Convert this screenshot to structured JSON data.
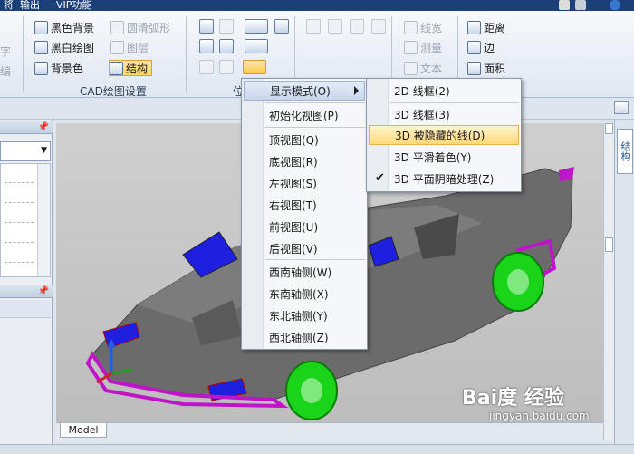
{
  "menubar": {
    "items": [
      "将",
      "输出",
      "VIP功能"
    ]
  },
  "ribbon": {
    "left_fragments": [
      "字",
      "编"
    ],
    "display_group": {
      "items": [
        {
          "label": "黑色背景",
          "enabled": true
        },
        {
          "label": "黑白绘图",
          "enabled": true
        },
        {
          "label": "背景色",
          "enabled": true
        },
        {
          "label": "圆滑弧形",
          "enabled": false
        },
        {
          "label": "图层",
          "enabled": false
        },
        {
          "label": "结构",
          "enabled": true,
          "active": true
        }
      ],
      "label": "CAD绘图设置"
    },
    "position_group_label": "位",
    "measure_group": {
      "items": [
        {
          "label": "线宽",
          "enabled": false
        },
        {
          "label": "测量",
          "enabled": false
        },
        {
          "label": "文本",
          "enabled": false
        },
        {
          "label": "距离",
          "enabled": true
        },
        {
          "label": "边",
          "enabled": true
        },
        {
          "label": "面积",
          "enabled": true
        }
      ]
    }
  },
  "right_panel": {
    "tab_label": "结构"
  },
  "viewport": {
    "model_tab": "Model"
  },
  "context_menu": {
    "items": [
      {
        "label": "显示模式(O)",
        "has_submenu": true,
        "highlighted": true
      },
      {
        "label": "初始化视图(P)"
      },
      {
        "label": "顶视图(Q)"
      },
      {
        "label": "底视图(R)"
      },
      {
        "label": "左视图(S)"
      },
      {
        "label": "右视图(T)"
      },
      {
        "label": "前视图(U)"
      },
      {
        "label": "后视图(V)"
      },
      {
        "label": "西南轴侧(W)"
      },
      {
        "label": "东南轴侧(X)"
      },
      {
        "label": "东北轴侧(Y)"
      },
      {
        "label": "西北轴侧(Z)"
      }
    ]
  },
  "submenu": {
    "items": [
      {
        "label": "2D 线框(2)"
      },
      {
        "label": "3D 线框(3)"
      },
      {
        "label": "3D 被隐藏的线(D)",
        "highlighted": true
      },
      {
        "label": "3D 平滑着色(Y)"
      },
      {
        "label": "3D 平面阴暗处理(Z)",
        "checked": true
      }
    ]
  },
  "watermark": {
    "brand": "Bai度",
    "site_cn": "经验",
    "url": "jingyan.baidu.com"
  },
  "colors": {
    "ribbon_accent": "#ffd25c",
    "car_body": "#6b6b6b",
    "window_blue": "#1f1fe0",
    "wheel_green": "#19d419",
    "trim_magenta": "#c014c8"
  }
}
